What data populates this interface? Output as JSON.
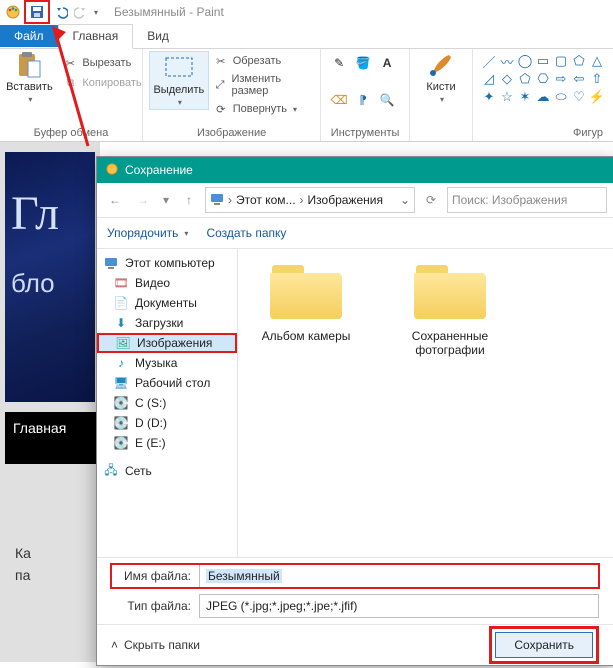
{
  "title": {
    "doc": "Безымянный",
    "app": "Paint"
  },
  "tabs": {
    "file": "Файл",
    "home": "Главная",
    "view": "Вид"
  },
  "ribbon": {
    "clipboard": {
      "paste": "Вставить",
      "cut": "Вырезать",
      "copy": "Копировать",
      "group": "Буфер обмена"
    },
    "image": {
      "select": "Выделить",
      "crop": "Обрезать",
      "resize": "Изменить размер",
      "rotate": "Повернуть",
      "group": "Изображение"
    },
    "tools": {
      "group": "Инструменты"
    },
    "brush": {
      "label": "Кисти"
    },
    "shapes": {
      "group": "Фигур"
    }
  },
  "canvas": {
    "line1": "Гл",
    "line2": "бло",
    "strip": "Главная",
    "below1": "Ка",
    "below2": "па"
  },
  "dialog": {
    "title": "Сохранение",
    "crumb1": "Этот ком...",
    "crumb2": "Изображения",
    "search_placeholder": "Поиск: Изображения",
    "organize": "Упорядочить",
    "newfolder": "Создать папку",
    "tree": {
      "thispc": "Этот компьютер",
      "video": "Видео",
      "documents": "Документы",
      "downloads": "Загрузки",
      "pictures": "Изображения",
      "music": "Музыка",
      "desktop": "Рабочий стол",
      "c": "C (S:)",
      "d": "D (D:)",
      "e": "E (E:)",
      "network": "Сеть"
    },
    "folders": {
      "camera": "Альбом камеры",
      "saved": "Сохраненные фотографии"
    },
    "filename_label": "Имя файла:",
    "filename_value": "Безымянный",
    "filetype_label": "Тип файла:",
    "filetype_value": "JPEG (*.jpg;*.jpeg;*.jpe;*.jfif)",
    "hide_folders": "Скрыть папки",
    "save": "Сохранить"
  }
}
